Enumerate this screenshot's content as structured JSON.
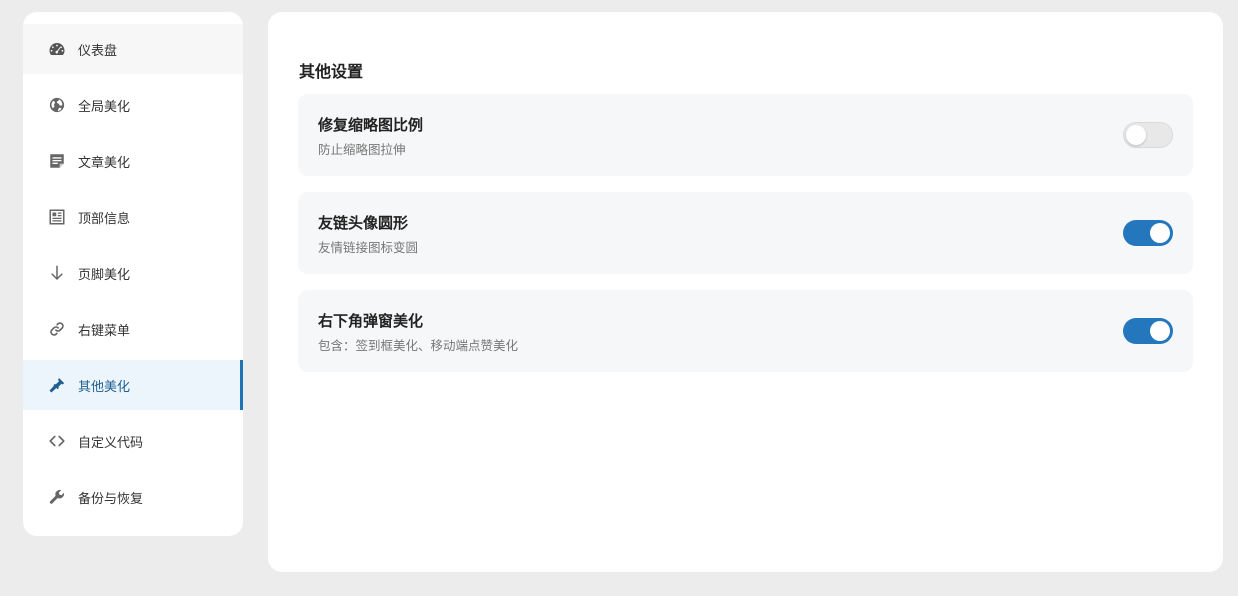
{
  "colors": {
    "background": "#ececec",
    "accent": "#1e74b4",
    "toggle_on": "#2577bd",
    "toggle_off": "#e8e8e8",
    "active_nav_bg": "#edf5fc"
  },
  "sidebar": {
    "items": [
      {
        "label": "仪表盘",
        "icon": "dashboard-icon",
        "state": "hover"
      },
      {
        "label": "全局美化",
        "icon": "globe-icon"
      },
      {
        "label": "文章美化",
        "icon": "article-icon"
      },
      {
        "label": "顶部信息",
        "icon": "newspaper-icon"
      },
      {
        "label": "页脚美化",
        "icon": "arrow-down-icon"
      },
      {
        "label": "右键菜单",
        "icon": "link-icon"
      },
      {
        "label": "其他美化",
        "icon": "brush-icon",
        "state": "active"
      },
      {
        "label": "自定义代码",
        "icon": "code-icon"
      },
      {
        "label": "备份与恢复",
        "icon": "wrench-icon"
      }
    ]
  },
  "main": {
    "section_title": "其他设置",
    "settings": [
      {
        "title": "修复缩略图比例",
        "desc": "防止缩略图拉伸",
        "enabled": false
      },
      {
        "title": "友链头像圆形",
        "desc": "友情链接图标变圆",
        "enabled": true
      },
      {
        "title": "右下角弹窗美化",
        "desc": "包含：签到框美化、移动端点赞美化",
        "enabled": true
      }
    ]
  }
}
